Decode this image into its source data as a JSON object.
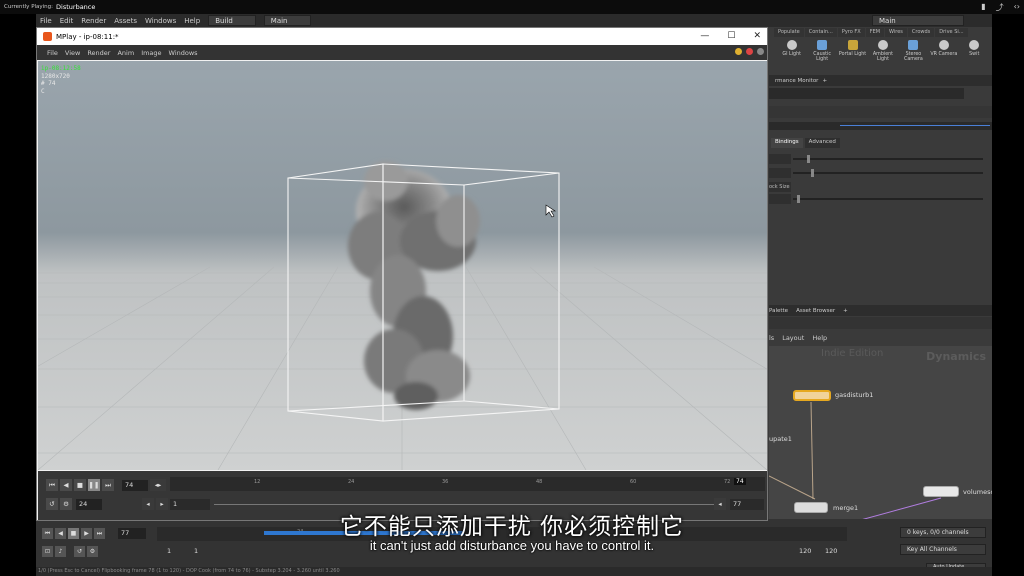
{
  "overlay": {
    "playing_label": "Currently Playing:",
    "video_title": "Disturbance",
    "icons": [
      "bookmark-icon",
      "share-icon",
      "code-icon"
    ]
  },
  "houdini": {
    "menu": [
      "File",
      "Edit",
      "Render",
      "Assets",
      "Windows",
      "Help"
    ],
    "desktop": "Build",
    "context": "Main",
    "right_context": "Main",
    "shelf_tabs": [
      "Populate",
      "Contain...",
      "Pyro FX",
      "FEM",
      "Wires",
      "Crowds",
      "Drive Si..."
    ],
    "shelf_tools": [
      {
        "label": "GI Light"
      },
      {
        "label": "Caustic Light"
      },
      {
        "label": "Portal Light"
      },
      {
        "label": "Ambient Light"
      },
      {
        "label": "Stereo Camera"
      },
      {
        "label": "VR Camera"
      },
      {
        "label": "Swit"
      }
    ],
    "pane_tab": "rmance Monitor",
    "param_tabs": [
      "Bindings",
      "Advanced"
    ],
    "param_label": "ock Size",
    "network_tabs": [
      "Palette",
      "Asset Browser"
    ],
    "network_menu": [
      "ls",
      "Layout",
      "Help"
    ],
    "watermark_edition": "Indie Edition",
    "watermark_context": "Dynamics",
    "nodes": [
      {
        "name": "gasdisturb1"
      },
      {
        "name": "upate1"
      },
      {
        "name": "merge1"
      },
      {
        "name": "volumesource1"
      }
    ],
    "timeline": {
      "frame": "77",
      "start": "1",
      "start2": "1",
      "end": "120",
      "end2": "120",
      "tick": "24",
      "tick_right": "12",
      "keys": "0 keys, 0/0 channels",
      "key_all": "Key All Channels",
      "auto_update": "Auto Update",
      "status": "1/0 (Press Esc to Cancel) Flipbooking frame 78 (1 to 120) - DOP Cook (from 74 to 76) - Substep 3.204 - 3.260 until 3.260"
    }
  },
  "mplay": {
    "title": "MPlay - ip-08:11:*",
    "menu": [
      "File",
      "View",
      "Render",
      "Anim",
      "Image",
      "Windows"
    ],
    "window_controls": [
      "minimize-icon",
      "maximize-icon",
      "close-icon"
    ],
    "info": [
      "ip-08:12:58",
      "1280x720",
      "# 74",
      "C"
    ],
    "controls": {
      "frame": "74",
      "step": "24",
      "start": "1",
      "end": "77",
      "marker": "74",
      "ticks": [
        "12",
        "24",
        "36",
        "48",
        "60",
        "72"
      ]
    }
  },
  "subtitles": {
    "cn": "它不能只添加干扰 你必须控制它",
    "en": "it can't just add disturbance you have to control it."
  }
}
